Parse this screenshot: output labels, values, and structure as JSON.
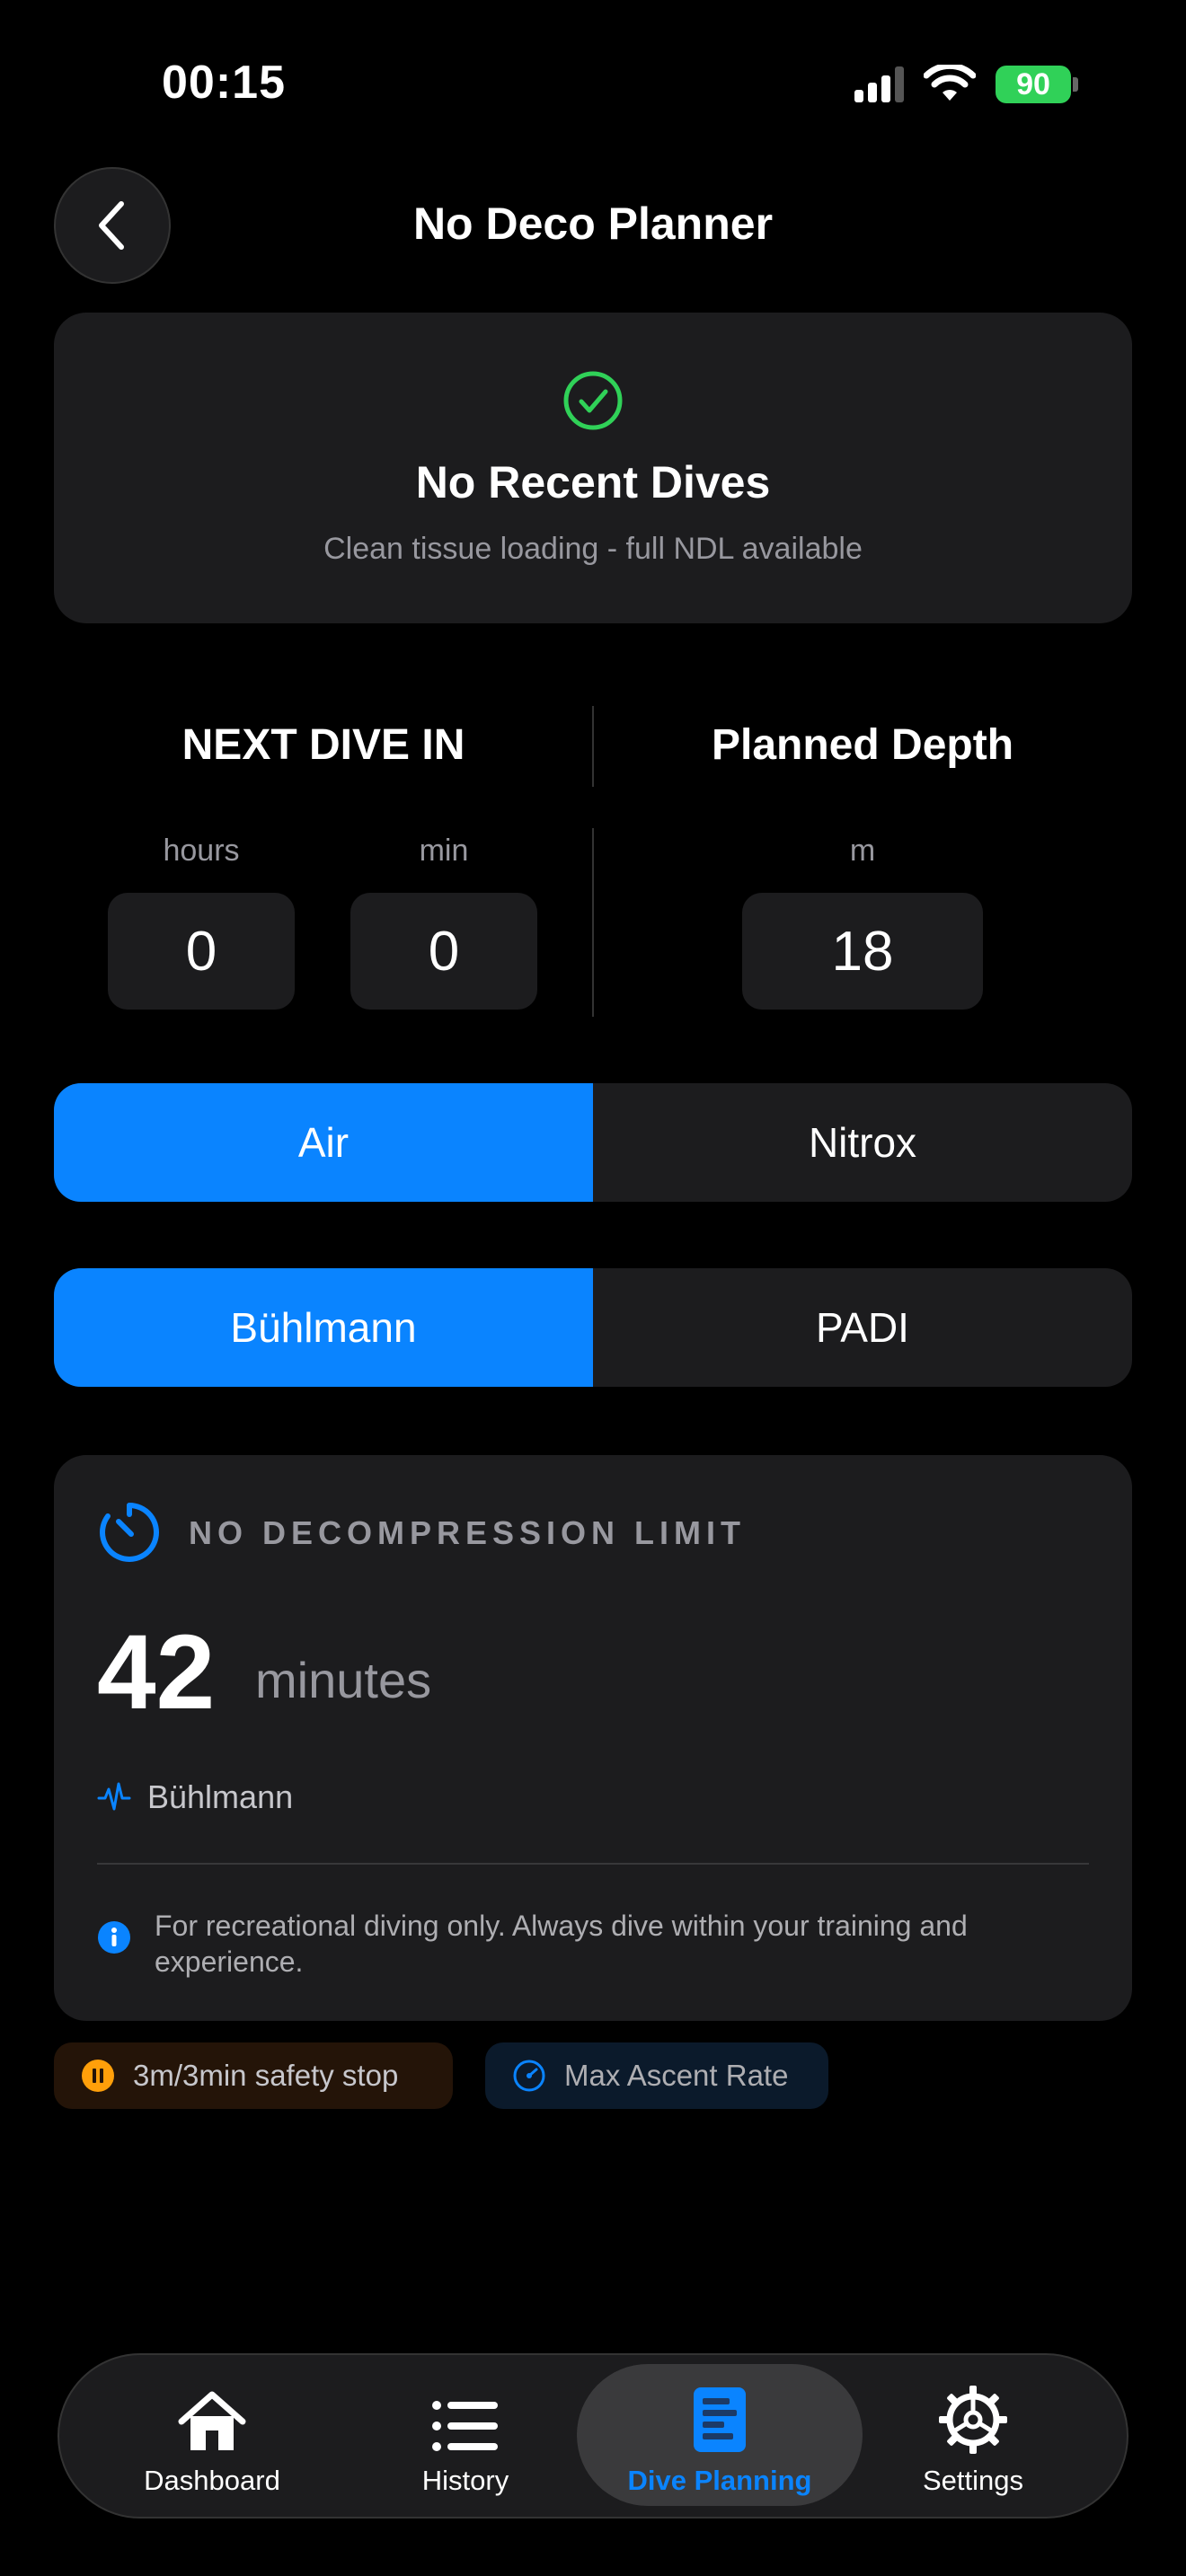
{
  "status_bar": {
    "time": "00:15",
    "battery_percent": "90"
  },
  "header": {
    "title": "No Deco Planner"
  },
  "recent_dives": {
    "title": "No Recent Dives",
    "subtitle": "Clean tissue loading - full NDL available"
  },
  "next_dive": {
    "label": "NEXT DIVE IN",
    "hours_label": "hours",
    "hours_value": "0",
    "min_label": "min",
    "min_value": "0"
  },
  "planned_depth": {
    "label": "Planned Depth",
    "unit": "m",
    "value": "18"
  },
  "gas_selector": {
    "options": [
      "Air",
      "Nitrox"
    ],
    "selected": "Air"
  },
  "algorithm_selector": {
    "options": [
      "Bühlmann",
      "PADI"
    ],
    "selected": "Bühlmann"
  },
  "ndl": {
    "label": "NO DECOMPRESSION LIMIT",
    "value": "42",
    "unit": "minutes",
    "algorithm": "Bühlmann",
    "disclaimer": "For recreational diving only. Always dive within your training and experience."
  },
  "pills": {
    "safety_stop": "3m/3min safety stop",
    "ascent_rate": "Max Ascent Rate"
  },
  "tabs": [
    {
      "label": "Dashboard",
      "icon": "house-icon"
    },
    {
      "label": "History",
      "icon": "list-icon"
    },
    {
      "label": "Dive Planning",
      "icon": "planning-icon"
    },
    {
      "label": "Settings",
      "icon": "gear-icon"
    }
  ],
  "colors": {
    "accent": "#0a84ff",
    "success": "#30d158",
    "warning": "#ff9f0a",
    "card": "#1c1c1e",
    "background": "#000000"
  }
}
